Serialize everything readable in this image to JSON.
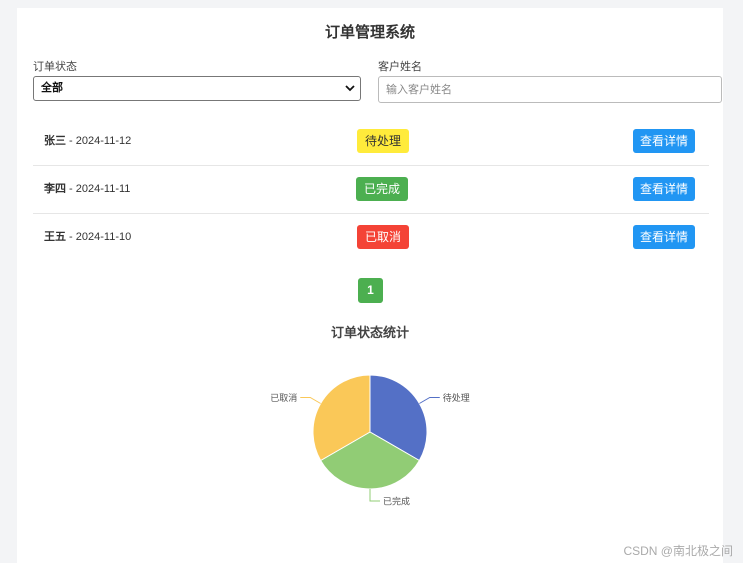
{
  "header": {
    "title": "订单管理系统"
  },
  "filters": {
    "status_label": "订单状态",
    "status_value": "全部",
    "name_label": "客户姓名",
    "name_placeholder": "输入客户姓名",
    "name_value": ""
  },
  "orders": [
    {
      "name": "张三",
      "sep": " - ",
      "date": "2024-11-12",
      "status": "待处理",
      "status_bg": "#ffeb3b",
      "status_fg": "#333333",
      "action": "查看详情"
    },
    {
      "name": "李四",
      "sep": " - ",
      "date": "2024-11-11",
      "status": "已完成",
      "status_bg": "#4caf50",
      "status_fg": "#ffffff",
      "action": "查看详情"
    },
    {
      "name": "王五",
      "sep": " - ",
      "date": "2024-11-10",
      "status": "已取消",
      "status_bg": "#f44336",
      "status_fg": "#ffffff",
      "action": "查看详情"
    }
  ],
  "pagination": {
    "current": "1"
  },
  "chart_title": "订单状态统计",
  "chart_data": {
    "type": "pie",
    "title": "订单状态统计",
    "categories": [
      "待处理",
      "已完成",
      "已取消"
    ],
    "values": [
      1,
      1,
      1
    ],
    "colors": [
      "#5470c6",
      "#91cc75",
      "#fac858"
    ]
  },
  "watermark": "CSDN @南北极之间"
}
